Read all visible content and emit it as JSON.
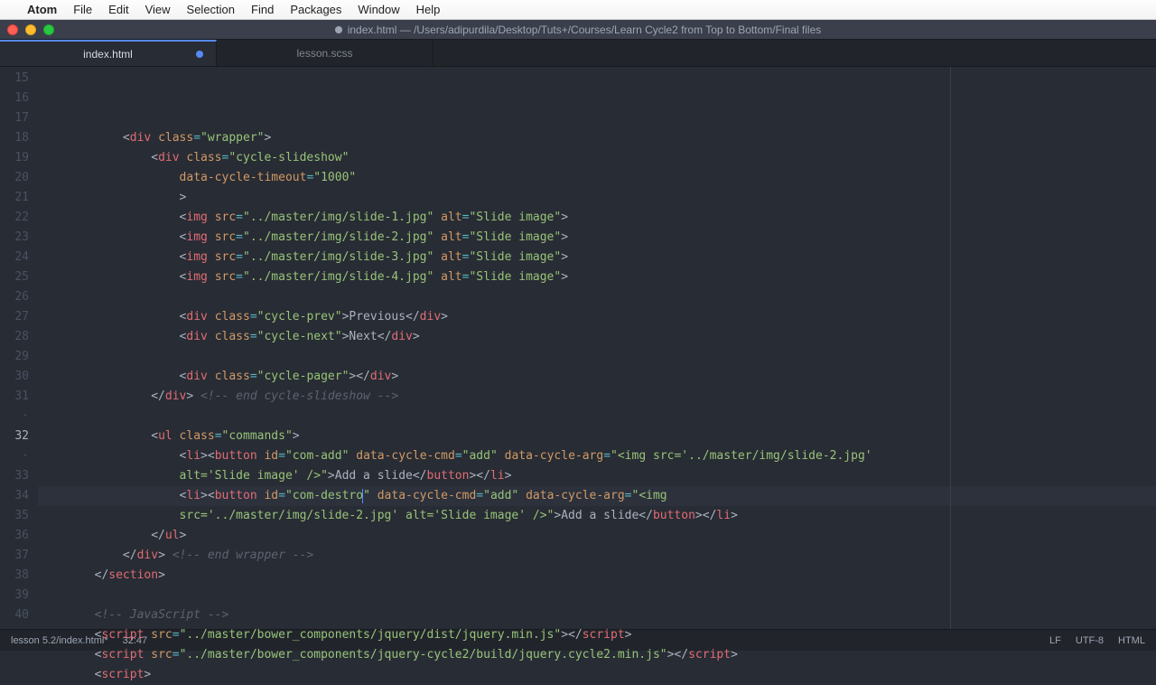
{
  "menubar": {
    "apple": "",
    "app": "Atom",
    "items": [
      "File",
      "Edit",
      "View",
      "Selection",
      "Find",
      "Packages",
      "Window",
      "Help"
    ]
  },
  "window": {
    "title": "index.html — /Users/adipurdila/Desktop/Tuts+/Courses/Learn Cycle2 from Top to Bottom/Final files"
  },
  "tabs": [
    {
      "label": "index.html",
      "active": true,
      "modified": true
    },
    {
      "label": "lesson.scss",
      "active": false,
      "modified": false
    }
  ],
  "gutter": {
    "start": 15,
    "labels": [
      "15",
      "16",
      "17",
      "18",
      "19",
      "20",
      "21",
      "22",
      "23",
      "24",
      "25",
      "26",
      "27",
      "28",
      "29",
      "30",
      "31",
      "·",
      "32",
      "·",
      "33",
      "34",
      "35",
      "36",
      "37",
      "38",
      "39",
      "40"
    ],
    "current_index": 18
  },
  "code": {
    "lines": [
      {
        "indent": 12,
        "tokens": [
          [
            "p",
            "<"
          ],
          [
            "tg",
            "div"
          ],
          [
            "p",
            " "
          ],
          [
            "at",
            "class"
          ],
          [
            "op",
            "="
          ],
          [
            "st",
            "\"wrapper\""
          ],
          [
            "p",
            ">"
          ]
        ]
      },
      {
        "indent": 16,
        "tokens": [
          [
            "p",
            "<"
          ],
          [
            "tg",
            "div"
          ],
          [
            "p",
            " "
          ],
          [
            "at",
            "class"
          ],
          [
            "op",
            "="
          ],
          [
            "st",
            "\"cycle-slideshow\""
          ]
        ]
      },
      {
        "indent": 20,
        "tokens": [
          [
            "at",
            "data-cycle-timeout"
          ],
          [
            "op",
            "="
          ],
          [
            "st",
            "\"1000\""
          ]
        ]
      },
      {
        "indent": 20,
        "tokens": [
          [
            "p",
            ">"
          ]
        ]
      },
      {
        "indent": 20,
        "tokens": [
          [
            "p",
            "<"
          ],
          [
            "tg",
            "img"
          ],
          [
            "p",
            " "
          ],
          [
            "at",
            "src"
          ],
          [
            "op",
            "="
          ],
          [
            "st",
            "\"../master/img/slide-1.jpg\""
          ],
          [
            "p",
            " "
          ],
          [
            "at",
            "alt"
          ],
          [
            "op",
            "="
          ],
          [
            "st",
            "\"Slide image\""
          ],
          [
            "p",
            ">"
          ]
        ]
      },
      {
        "indent": 20,
        "tokens": [
          [
            "p",
            "<"
          ],
          [
            "tg",
            "img"
          ],
          [
            "p",
            " "
          ],
          [
            "at",
            "src"
          ],
          [
            "op",
            "="
          ],
          [
            "st",
            "\"../master/img/slide-2.jpg\""
          ],
          [
            "p",
            " "
          ],
          [
            "at",
            "alt"
          ],
          [
            "op",
            "="
          ],
          [
            "st",
            "\"Slide image\""
          ],
          [
            "p",
            ">"
          ]
        ]
      },
      {
        "indent": 20,
        "tokens": [
          [
            "p",
            "<"
          ],
          [
            "tg",
            "img"
          ],
          [
            "p",
            " "
          ],
          [
            "at",
            "src"
          ],
          [
            "op",
            "="
          ],
          [
            "st",
            "\"../master/img/slide-3.jpg\""
          ],
          [
            "p",
            " "
          ],
          [
            "at",
            "alt"
          ],
          [
            "op",
            "="
          ],
          [
            "st",
            "\"Slide image\""
          ],
          [
            "p",
            ">"
          ]
        ]
      },
      {
        "indent": 20,
        "tokens": [
          [
            "p",
            "<"
          ],
          [
            "tg",
            "img"
          ],
          [
            "p",
            " "
          ],
          [
            "at",
            "src"
          ],
          [
            "op",
            "="
          ],
          [
            "st",
            "\"../master/img/slide-4.jpg\""
          ],
          [
            "p",
            " "
          ],
          [
            "at",
            "alt"
          ],
          [
            "op",
            "="
          ],
          [
            "st",
            "\"Slide image\""
          ],
          [
            "p",
            ">"
          ]
        ]
      },
      {
        "indent": 0,
        "tokens": []
      },
      {
        "indent": 20,
        "tokens": [
          [
            "p",
            "<"
          ],
          [
            "tg",
            "div"
          ],
          [
            "p",
            " "
          ],
          [
            "at",
            "class"
          ],
          [
            "op",
            "="
          ],
          [
            "st",
            "\"cycle-prev\""
          ],
          [
            "p",
            ">Previous</"
          ],
          [
            "tg",
            "div"
          ],
          [
            "p",
            ">"
          ]
        ]
      },
      {
        "indent": 20,
        "tokens": [
          [
            "p",
            "<"
          ],
          [
            "tg",
            "div"
          ],
          [
            "p",
            " "
          ],
          [
            "at",
            "class"
          ],
          [
            "op",
            "="
          ],
          [
            "st",
            "\"cycle-next\""
          ],
          [
            "p",
            ">Next</"
          ],
          [
            "tg",
            "div"
          ],
          [
            "p",
            ">"
          ]
        ]
      },
      {
        "indent": 0,
        "tokens": []
      },
      {
        "indent": 20,
        "tokens": [
          [
            "p",
            "<"
          ],
          [
            "tg",
            "div"
          ],
          [
            "p",
            " "
          ],
          [
            "at",
            "class"
          ],
          [
            "op",
            "="
          ],
          [
            "st",
            "\"cycle-pager\""
          ],
          [
            "p",
            "></"
          ],
          [
            "tg",
            "div"
          ],
          [
            "p",
            ">"
          ]
        ]
      },
      {
        "indent": 16,
        "tokens": [
          [
            "p",
            "</"
          ],
          [
            "tg",
            "div"
          ],
          [
            "p",
            "> "
          ],
          [
            "cm",
            "<!-- end cycle-slideshow -->"
          ]
        ]
      },
      {
        "indent": 0,
        "tokens": []
      },
      {
        "indent": 16,
        "tokens": [
          [
            "p",
            "<"
          ],
          [
            "tg",
            "ul"
          ],
          [
            "p",
            " "
          ],
          [
            "at",
            "class"
          ],
          [
            "op",
            "="
          ],
          [
            "st",
            "\"commands\""
          ],
          [
            "p",
            ">"
          ]
        ]
      },
      {
        "indent": 20,
        "tokens": [
          [
            "p",
            "<"
          ],
          [
            "tg",
            "li"
          ],
          [
            "p",
            "><"
          ],
          [
            "tg",
            "button"
          ],
          [
            "p",
            " "
          ],
          [
            "at",
            "id"
          ],
          [
            "op",
            "="
          ],
          [
            "st",
            "\"com-add\""
          ],
          [
            "p",
            " "
          ],
          [
            "at",
            "data-cycle-cmd"
          ],
          [
            "op",
            "="
          ],
          [
            "st",
            "\"add\""
          ],
          [
            "p",
            " "
          ],
          [
            "at",
            "data-cycle-arg"
          ],
          [
            "op",
            "="
          ],
          [
            "st",
            "\"<img src='../master/img/slide-2.jpg'"
          ]
        ]
      },
      {
        "indent": 20,
        "tokens": [
          [
            "st",
            "alt='Slide image' />\""
          ],
          [
            "p",
            ">Add a slide</"
          ],
          [
            "tg",
            "button"
          ],
          [
            "p",
            "></"
          ],
          [
            "tg",
            "li"
          ],
          [
            "p",
            ">"
          ]
        ]
      },
      {
        "indent": 20,
        "hl": true,
        "tokens": [
          [
            "p",
            "<"
          ],
          [
            "tg",
            "li"
          ],
          [
            "p",
            "><"
          ],
          [
            "tg",
            "button"
          ],
          [
            "p",
            " "
          ],
          [
            "at",
            "id"
          ],
          [
            "op",
            "="
          ],
          [
            "st",
            "\"com-destro"
          ],
          [
            "cursor",
            ""
          ],
          [
            "st",
            "\""
          ],
          [
            "p",
            " "
          ],
          [
            "at",
            "data-cycle-cmd"
          ],
          [
            "op",
            "="
          ],
          [
            "st",
            "\"add\""
          ],
          [
            "p",
            " "
          ],
          [
            "at",
            "data-cycle-arg"
          ],
          [
            "op",
            "="
          ],
          [
            "st",
            "\"<img"
          ]
        ]
      },
      {
        "indent": 20,
        "tokens": [
          [
            "st",
            "src='../master/img/slide-2.jpg' alt='Slide image' />\""
          ],
          [
            "p",
            ">Add a slide</"
          ],
          [
            "tg",
            "button"
          ],
          [
            "p",
            "></"
          ],
          [
            "tg",
            "li"
          ],
          [
            "p",
            ">"
          ]
        ]
      },
      {
        "indent": 16,
        "tokens": [
          [
            "p",
            "</"
          ],
          [
            "tg",
            "ul"
          ],
          [
            "p",
            ">"
          ]
        ]
      },
      {
        "indent": 12,
        "tokens": [
          [
            "p",
            "</"
          ],
          [
            "tg",
            "div"
          ],
          [
            "p",
            "> "
          ],
          [
            "cm",
            "<!-- end wrapper -->"
          ]
        ]
      },
      {
        "indent": 8,
        "tokens": [
          [
            "p",
            "</"
          ],
          [
            "tg",
            "section"
          ],
          [
            "p",
            ">"
          ]
        ]
      },
      {
        "indent": 0,
        "tokens": []
      },
      {
        "indent": 8,
        "tokens": [
          [
            "cm",
            "<!-- JavaScript -->"
          ]
        ]
      },
      {
        "indent": 8,
        "tokens": [
          [
            "p",
            "<"
          ],
          [
            "tg",
            "script"
          ],
          [
            "p",
            " "
          ],
          [
            "at",
            "src"
          ],
          [
            "op",
            "="
          ],
          [
            "st",
            "\"../master/bower_components/jquery/dist/jquery.min.js\""
          ],
          [
            "p",
            "></"
          ],
          [
            "tg",
            "script"
          ],
          [
            "p",
            ">"
          ]
        ]
      },
      {
        "indent": 8,
        "tokens": [
          [
            "p",
            "<"
          ],
          [
            "tg",
            "script"
          ],
          [
            "p",
            " "
          ],
          [
            "at",
            "src"
          ],
          [
            "op",
            "="
          ],
          [
            "st",
            "\"../master/bower_components/jquery-cycle2/build/jquery.cycle2.min.js\""
          ],
          [
            "p",
            "></"
          ],
          [
            "tg",
            "script"
          ],
          [
            "p",
            ">"
          ]
        ]
      },
      {
        "indent": 8,
        "tokens": [
          [
            "p",
            "<"
          ],
          [
            "tg",
            "script"
          ],
          [
            "p",
            ">"
          ]
        ]
      }
    ]
  },
  "statusbar": {
    "path": "lesson 5.2/index.html*",
    "cursor": "32:47",
    "line_ending": "LF",
    "encoding": "UTF-8",
    "grammar": "HTML"
  }
}
